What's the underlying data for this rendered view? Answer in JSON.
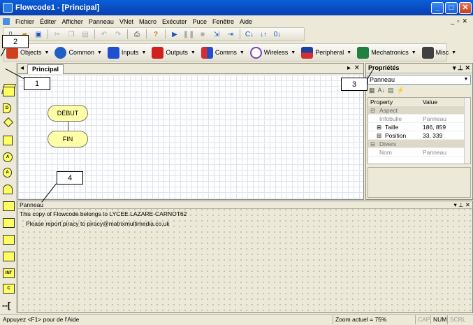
{
  "window": {
    "title": "Flowcode1 - [Principal]",
    "min": "_",
    "max": "□",
    "close": "✕"
  },
  "menu": {
    "items": [
      "Fichier",
      "Éditer",
      "Afficher",
      "Panneau",
      "VNet",
      "Macro",
      "Exécuter",
      "Puce",
      "Fenêtre",
      "Aide"
    ],
    "mdi": [
      "_",
      "▫",
      "✕"
    ]
  },
  "toolbar2": {
    "buttons": [
      "Objects",
      "Common",
      "Inputs",
      "Outputs",
      "Comms",
      "Wireless",
      "Peripheral",
      "Mechatronics",
      "Misc"
    ],
    "icon_colors": [
      "#d04020",
      "#2060c0",
      "#2050d0",
      "#d02020",
      "#d03030",
      "#8040c0",
      "#2040a0",
      "#208040",
      "#404040"
    ]
  },
  "palette": [
    "",
    "",
    "D",
    "",
    "",
    "A",
    "A",
    "",
    "",
    "",
    "",
    "",
    "INT",
    "C"
  ],
  "document": {
    "tab": "Principal",
    "nodes": {
      "start": "DÉBUT",
      "end": "FIN"
    }
  },
  "properties": {
    "title": "Propriétés",
    "object": "Panneau",
    "headers": {
      "property": "Property",
      "value": "Value"
    },
    "rows": [
      {
        "kind": "cat",
        "name": "Aspect",
        "value": ""
      },
      {
        "kind": "dim",
        "name": "Infobulle",
        "value": "Panneau"
      },
      {
        "kind": "exp",
        "name": "Taille",
        "value": "186, 859"
      },
      {
        "kind": "exp",
        "name": "Position",
        "value": "33, 339"
      },
      {
        "kind": "cat",
        "name": "Divers",
        "value": ""
      },
      {
        "kind": "dim",
        "name": "Nom",
        "value": "Panneau"
      }
    ]
  },
  "panel": {
    "title": "Panneau",
    "line1": "This copy of Flowcode belongs to LYCEE LAZARE-CARNOT62",
    "line2": "Please report piracy to piracy@matrixmultimedia.co.uk"
  },
  "status": {
    "help": "Appuyez <F1> pour de l'Aide",
    "zoom": "Zoom actuel = 75%",
    "cap": "CAP",
    "num": "NUM",
    "scrl": "SCRL"
  },
  "callouts": [
    "1",
    "2",
    "3",
    "4"
  ]
}
